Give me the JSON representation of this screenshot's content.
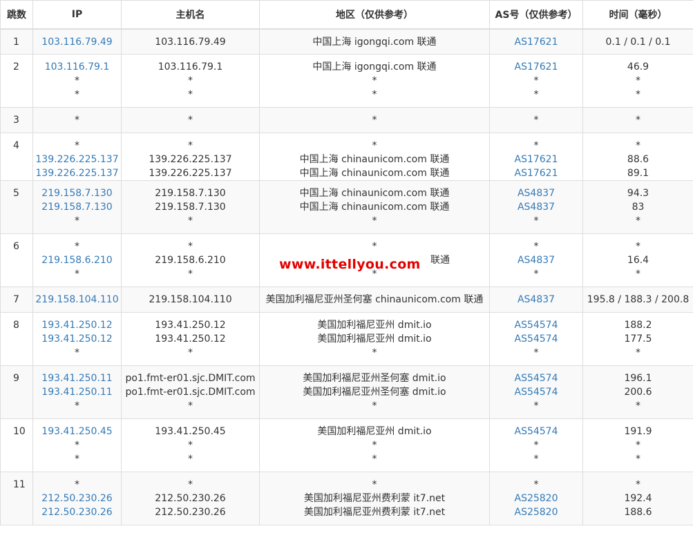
{
  "table": {
    "headers": {
      "hop": "跳数",
      "ip": "IP",
      "host": "主机名",
      "region": "地区（仅供参考）",
      "as": "AS号（仅供参考）",
      "time": "时间（毫秒）"
    },
    "rows": [
      {
        "hop": "1",
        "ip": [
          "103.116.79.49"
        ],
        "host": [
          "103.116.79.49"
        ],
        "region": [
          "中国上海 igongqi.com 联通"
        ],
        "as": [
          "AS17621"
        ],
        "time": [
          "0.1 / 0.1 / 0.1"
        ]
      },
      {
        "hop": "2",
        "ip": [
          "103.116.79.1",
          "*",
          "*"
        ],
        "host": [
          "103.116.79.1",
          "*",
          "*"
        ],
        "region": [
          "中国上海 igongqi.com 联通",
          "*",
          "*"
        ],
        "as": [
          "AS17621",
          "*",
          "*"
        ],
        "time": [
          "46.9",
          "*",
          "*"
        ]
      },
      {
        "hop": "3",
        "ip": [
          "*"
        ],
        "host": [
          "*"
        ],
        "region": [
          "*"
        ],
        "as": [
          "*"
        ],
        "time": [
          "*"
        ]
      },
      {
        "hop": "4",
        "ip": [
          "*",
          "139.226.225.137",
          "139.226.225.137"
        ],
        "host": [
          "*",
          "139.226.225.137",
          "139.226.225.137"
        ],
        "region": [
          "*",
          "中国上海 chinaunicom.com 联通",
          "中国上海 chinaunicom.com 联通"
        ],
        "as": [
          "*",
          "AS17621",
          "AS17621"
        ],
        "time": [
          "*",
          "88.6",
          "89.1"
        ]
      },
      {
        "hop": "5",
        "ip": [
          "219.158.7.130",
          "219.158.7.130",
          "*"
        ],
        "host": [
          "219.158.7.130",
          "219.158.7.130",
          "*"
        ],
        "region": [
          "中国上海 chinaunicom.com 联通",
          "中国上海 chinaunicom.com 联通",
          "*"
        ],
        "as": [
          "AS4837",
          "AS4837",
          "*"
        ],
        "time": [
          "94.3",
          "83",
          "*"
        ]
      },
      {
        "hop": "6",
        "ip": [
          "*",
          "219.158.6.210",
          "*"
        ],
        "host": [
          "*",
          "219.158.6.210",
          "*"
        ],
        "region": [
          "*",
          "",
          "*"
        ],
        "as": [
          "*",
          "AS4837",
          "*"
        ],
        "time": [
          "*",
          "16.4",
          "*"
        ]
      },
      {
        "hop": "7",
        "ip": [
          "219.158.104.110"
        ],
        "host": [
          "219.158.104.110"
        ],
        "region": [
          "美国加利福尼亚州圣何塞 chinaunicom.com 联通"
        ],
        "as": [
          "AS4837"
        ],
        "time": [
          "195.8 / 188.3 / 200.8"
        ]
      },
      {
        "hop": "8",
        "ip": [
          "193.41.250.12",
          "193.41.250.12",
          "*"
        ],
        "host": [
          "193.41.250.12",
          "193.41.250.12",
          "*"
        ],
        "region": [
          "美国加利福尼亚州 dmit.io",
          "美国加利福尼亚州 dmit.io",
          "*"
        ],
        "as": [
          "AS54574",
          "AS54574",
          "*"
        ],
        "time": [
          "188.2",
          "177.5",
          "*"
        ]
      },
      {
        "hop": "9",
        "ip": [
          "193.41.250.11",
          "193.41.250.11",
          "*"
        ],
        "host": [
          "po1.fmt-er01.sjc.DMIT.com",
          "po1.fmt-er01.sjc.DMIT.com",
          "*"
        ],
        "region": [
          "美国加利福尼亚州圣何塞 dmit.io",
          "美国加利福尼亚州圣何塞 dmit.io",
          "*"
        ],
        "as": [
          "AS54574",
          "AS54574",
          "*"
        ],
        "time": [
          "196.1",
          "200.6",
          "*"
        ]
      },
      {
        "hop": "10",
        "ip": [
          "193.41.250.45",
          "*",
          "*"
        ],
        "host": [
          "193.41.250.45",
          "*",
          "*"
        ],
        "region": [
          "美国加利福尼亚州 dmit.io",
          "*",
          "*"
        ],
        "as": [
          "AS54574",
          "*",
          "*"
        ],
        "time": [
          "191.9",
          "*",
          "*"
        ]
      },
      {
        "hop": "11",
        "ip": [
          "*",
          "212.50.230.26",
          "212.50.230.26"
        ],
        "host": [
          "*",
          "212.50.230.26",
          "212.50.230.26"
        ],
        "region": [
          "*",
          "美国加利福尼亚州费利蒙 it7.net",
          "美国加利福尼亚州费利蒙 it7.net"
        ],
        "as": [
          "*",
          "AS25820",
          "AS25820"
        ],
        "time": [
          "*",
          "192.4",
          "188.6"
        ]
      }
    ]
  },
  "watermark": {
    "text": "www.ittellyou.com",
    "partial_region_suffix": "联通"
  },
  "colors": {
    "link": "#337ab7",
    "watermark": "#e30000",
    "border": "#dddddd",
    "stripe": "#f9f9f9"
  }
}
